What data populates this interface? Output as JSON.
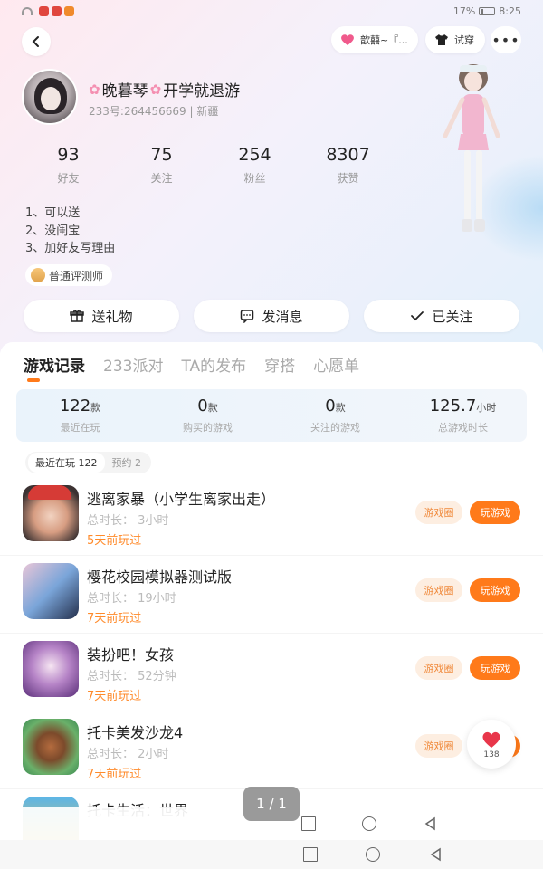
{
  "status_bar": {
    "battery": "17%",
    "time": "8:25"
  },
  "header": {
    "like_pill": "歆囍~『...",
    "try_pill": "试穿",
    "more": "•••"
  },
  "profile": {
    "flower": "✿",
    "name_part1": "晚暮琴",
    "name_part2": "开学就退游",
    "uid_line": "233号:264456669 | 新疆",
    "stats": [
      {
        "value": "93",
        "label": "好友"
      },
      {
        "value": "75",
        "label": "关注"
      },
      {
        "value": "254",
        "label": "粉丝"
      },
      {
        "value": "8307",
        "label": "获赞"
      }
    ],
    "bio": [
      "1、可以送",
      "2、没闺宝",
      "3、加好友写理由"
    ],
    "rank": "普通评测师"
  },
  "actions": {
    "gift": "送礼物",
    "message": "发消息",
    "follow": "已关注"
  },
  "tabs": [
    "游戏记录",
    "233派对",
    "TA的发布",
    "穿搭",
    "心愿单"
  ],
  "summary": [
    {
      "value": "122",
      "unit": "款",
      "label": "最近在玩"
    },
    {
      "value": "0",
      "unit": "款",
      "label": "购买的游戏"
    },
    {
      "value": "0",
      "unit": "款",
      "label": "关注的游戏"
    },
    {
      "value": "125.7",
      "unit": "小时",
      "label": "总游戏时长"
    }
  ],
  "subtabs": {
    "recent": "最近在玩 122",
    "reserve": "预约 2"
  },
  "games": [
    {
      "name": "逃离家暴（小学生离家出走）",
      "time": "总时长：  3小时",
      "last": "5天前玩过"
    },
    {
      "name": "樱花校园模拟器测试版",
      "time": "总时长：  19小时",
      "last": "7天前玩过"
    },
    {
      "name": "装扮吧！女孩",
      "time": "总时长：  52分钟",
      "last": "7天前玩过"
    },
    {
      "name": "托卡美发沙龙4",
      "time": "总时长：  2小时",
      "last": "7天前玩过"
    },
    {
      "name": "托卡生活：世界",
      "time": "",
      "last": ""
    }
  ],
  "game_buttons": {
    "circle": "游戏圈",
    "play": "玩游戏"
  },
  "like_count": "138",
  "page_indicator": "1 / 1",
  "colors": {
    "accent": "#ff7a1a",
    "accent_light": "#fdeee1"
  }
}
